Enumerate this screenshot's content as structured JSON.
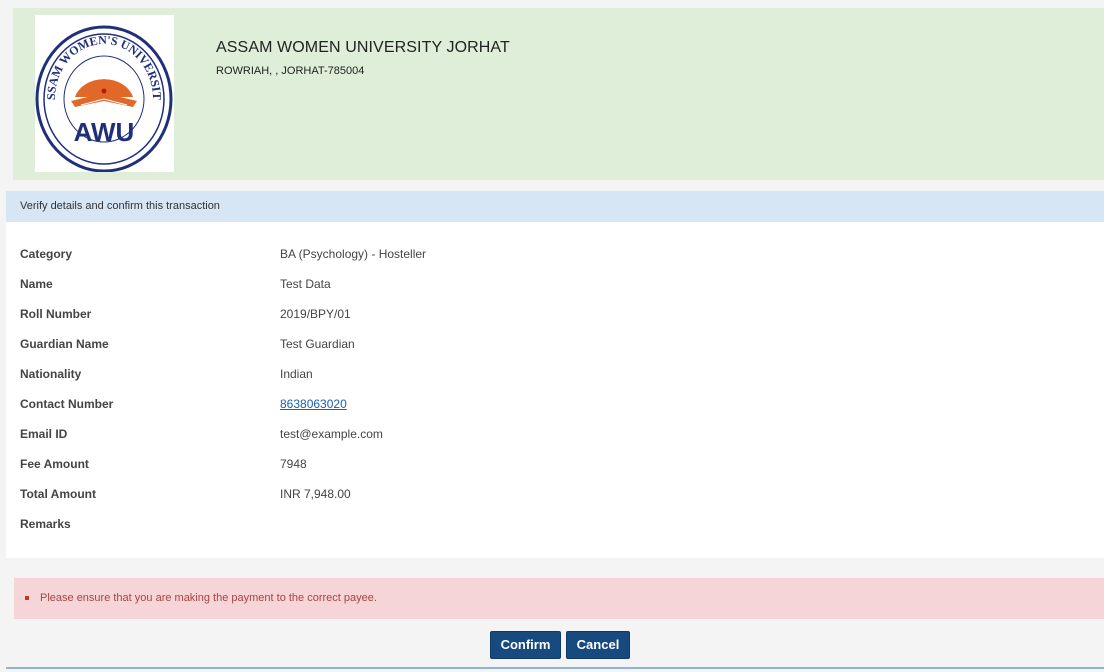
{
  "header": {
    "institution_name": "ASSAM WOMEN UNIVERSITY JORHAT",
    "address": "ROWRIAH, , JORHAT-785004",
    "logo": {
      "icon": "university-seal-icon",
      "ring_text": "ASSAM WOMEN'S UNIVERSITY",
      "abbreviation": "AWU"
    }
  },
  "verify_bar": {
    "text": "Verify details and confirm this transaction"
  },
  "details": [
    {
      "label": "Category",
      "value": "BA (Psychology) - Hosteller"
    },
    {
      "label": "Name",
      "value": "Test Data"
    },
    {
      "label": "Roll Number",
      "value": "2019/BPY/01"
    },
    {
      "label": "Guardian Name",
      "value": "Test Guardian"
    },
    {
      "label": "Nationality",
      "value": "Indian"
    },
    {
      "label": "Contact Number",
      "value": "8638063020"
    },
    {
      "label": "Email ID",
      "value": "test@example.com"
    },
    {
      "label": "Fee Amount",
      "value": "7948"
    },
    {
      "label": "Total Amount",
      "value": "INR 7,948.00"
    },
    {
      "label": "Remarks",
      "value": ""
    }
  ],
  "alert": {
    "text": "Please ensure that you are making the payment to the correct payee."
  },
  "actions": {
    "confirm_label": "Confirm",
    "cancel_label": "Cancel"
  },
  "colors": {
    "header_bg": "#dfeed8",
    "verify_bar_bg": "#d6e6f4",
    "alert_bg": "#f5d5d8",
    "button_bg": "#174a7e",
    "link": "#1a5fb4"
  }
}
